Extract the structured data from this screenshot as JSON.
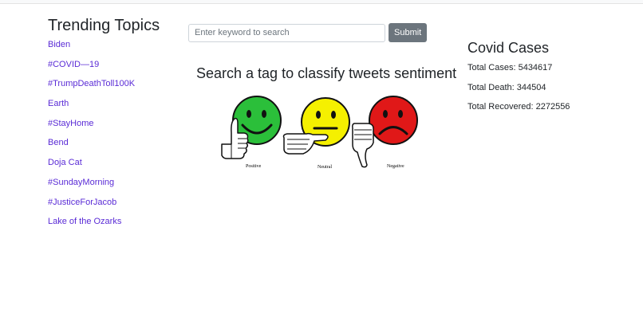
{
  "trending": {
    "title": "Trending Topics",
    "topics": [
      "Biden",
      "#COVID—19",
      "#TrumpDeathToll100K",
      "Earth",
      "#StayHome",
      "Bend",
      "Doja Cat",
      "#SundayMorning",
      "#JusticeForJacob",
      "Lake of the Ozarks"
    ]
  },
  "search": {
    "placeholder": "Enter keyword to search",
    "value": "",
    "submit_label": "Submit"
  },
  "main": {
    "heading": "Search a tag to classify tweets sentiment",
    "faces": [
      {
        "label": "Positive",
        "color": "#2bbf3a",
        "icon": "smiling-face-thumbs-up-icon"
      },
      {
        "label": "Neutral",
        "color": "#f5f000",
        "icon": "neutral-face-thumb-sideways-icon"
      },
      {
        "label": "Negative",
        "color": "#e01818",
        "icon": "frowning-face-thumbs-down-icon"
      }
    ]
  },
  "covid": {
    "title": "Covid Cases",
    "total_cases": "Total Cases: 5434617",
    "total_death": "Total Death: 344504",
    "total_recovered": "Total Recovered: 2272556"
  },
  "colors": {
    "link": "#5a2bd6",
    "button": "#6c757d"
  }
}
